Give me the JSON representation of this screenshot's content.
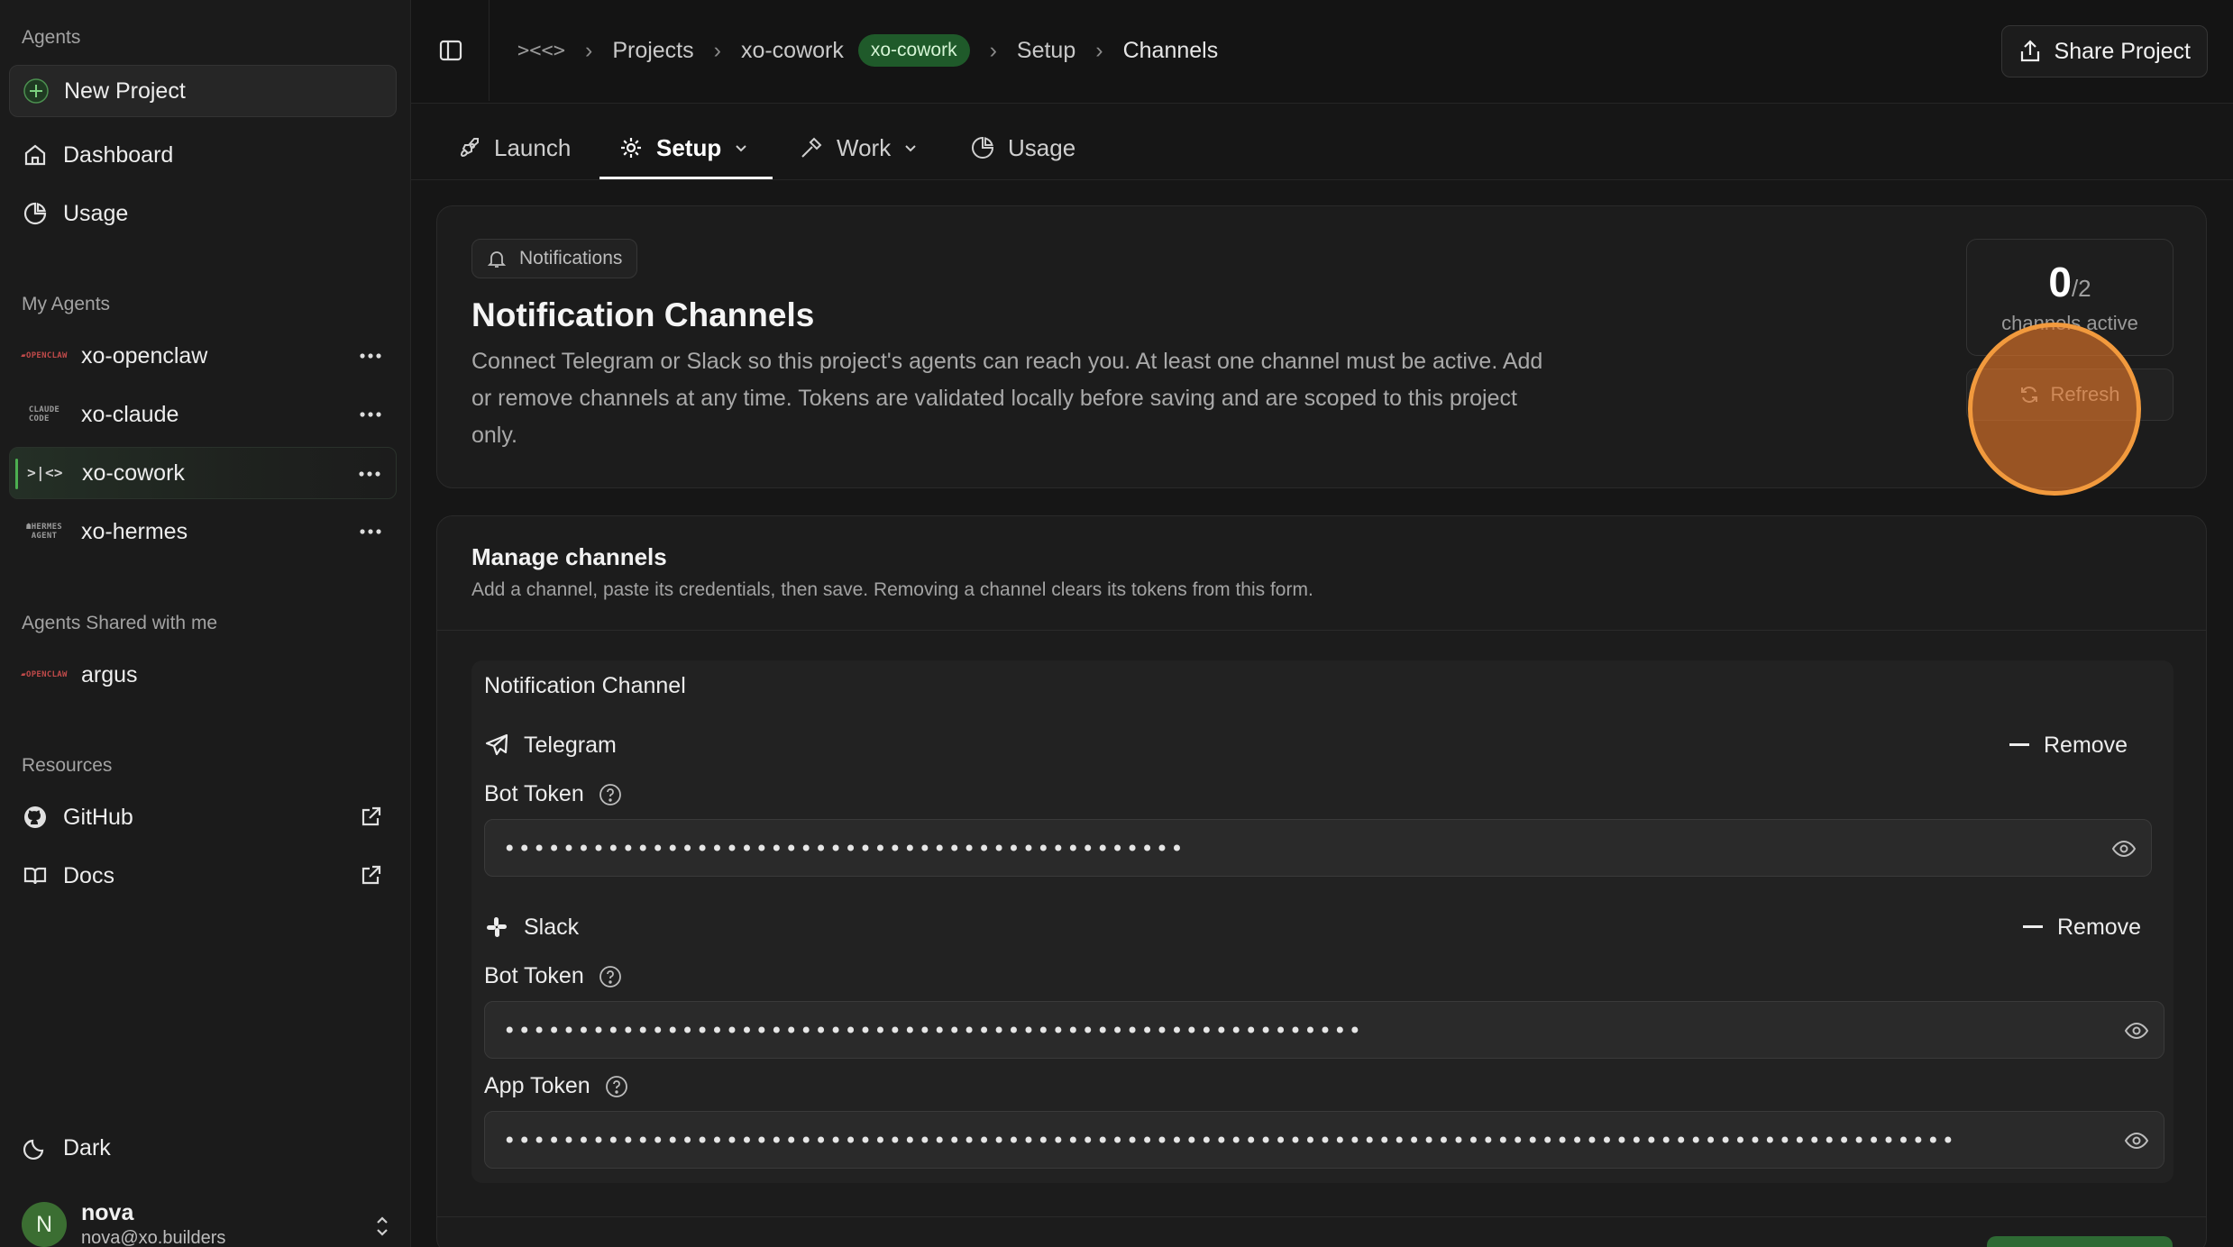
{
  "sidebar": {
    "agents_heading": "Agents",
    "new_project": "New Project",
    "nav": [
      {
        "label": "Dashboard",
        "icon": "home-icon"
      },
      {
        "label": "Usage",
        "icon": "pie-chart-icon"
      }
    ],
    "my_agents_heading": "My Agents",
    "my_agents": [
      {
        "label": "xo-openclaw",
        "logo": "OPENCLAW",
        "active": false
      },
      {
        "label": "xo-claude",
        "logo": "CLAUDE CODE",
        "active": false
      },
      {
        "label": "xo-cowork",
        "logo": ">|<>",
        "active": true
      },
      {
        "label": "xo-hermes",
        "logo": "HERMES AGENT",
        "active": false
      }
    ],
    "shared_heading": "Agents Shared with me",
    "shared_agents": [
      {
        "label": "argus",
        "logo": "OPENCLAW"
      }
    ],
    "resources_heading": "Resources",
    "resources": [
      {
        "label": "GitHub",
        "icon": "github-icon"
      },
      {
        "label": "Docs",
        "icon": "book-icon"
      }
    ],
    "theme_label": "Dark",
    "user": {
      "initial": "N",
      "name": "nova",
      "email": "nova@xo.builders"
    }
  },
  "topbar": {
    "logo": "><<>",
    "breadcrumbs": [
      "Projects",
      "xo-cowork",
      "Setup",
      "Channels"
    ],
    "project_badge": "xo-cowork",
    "share_label": "Share Project"
  },
  "tabs": [
    {
      "label": "Launch",
      "icon": "rocket-icon",
      "dropdown": false,
      "active": false
    },
    {
      "label": "Setup",
      "icon": "gear-icon",
      "dropdown": true,
      "active": true
    },
    {
      "label": "Work",
      "icon": "hammer-icon",
      "dropdown": true,
      "active": false
    },
    {
      "label": "Usage",
      "icon": "pie-chart-icon",
      "dropdown": false,
      "active": false
    }
  ],
  "notifications": {
    "pill": "Notifications",
    "title": "Notification Channels",
    "description": "Connect Telegram or Slack so this project's agents can reach you. At least one channel must be active. Add or remove channels at any time. Tokens are validated locally before saving and are scoped to this project only.",
    "stat": {
      "count": "0",
      "total": "/2",
      "label": "channels active"
    },
    "refresh_label": "Refresh"
  },
  "manage": {
    "title": "Manage channels",
    "subtitle": "Add a channel, paste its credentials, then save. Removing a channel clears its tokens from this form.",
    "section_title": "Notification Channel",
    "channels": [
      {
        "name": "Telegram",
        "icon": "telegram-icon",
        "remove_label": "Remove",
        "fields": [
          {
            "label": "Bot Token",
            "masked": "••••••••••••••••••••••••••••••••••••••••••••••"
          }
        ]
      },
      {
        "name": "Slack",
        "icon": "slack-icon",
        "remove_label": "Remove",
        "fields": [
          {
            "label": "Bot Token",
            "masked": "••••••••••••••••••••••••••••••••••••••••••••••••••••••••••"
          },
          {
            "label": "App Token",
            "masked": "••••••••••••••••••••••••••••••••••••••••••••••••••••••••••••••••••••••••••••••••••••••••••••••••••"
          }
        ]
      }
    ]
  },
  "colors": {
    "accent_green": "#1f5a2a",
    "click_highlight": "#f29a3d",
    "background": "#161616"
  }
}
